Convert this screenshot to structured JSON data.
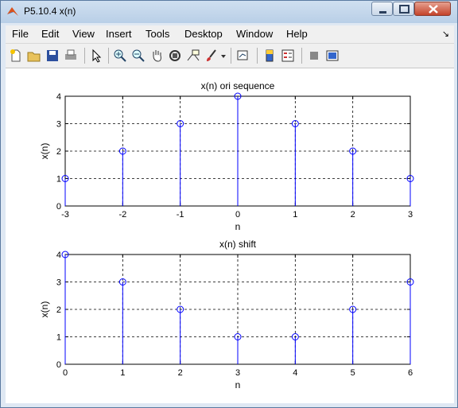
{
  "window": {
    "title": "P5.10.4 x(n)"
  },
  "menu": [
    "File",
    "Edit",
    "View",
    "Insert",
    "Tools",
    "Desktop",
    "Window",
    "Help"
  ],
  "toolbar": {
    "icons": [
      "new-figure-icon",
      "open-file-icon",
      "save-icon",
      "print-icon",
      "pointer-icon",
      "zoom-in-icon",
      "zoom-out-icon",
      "pan-hand-icon",
      "rotate-3d-icon",
      "data-cursor-icon",
      "brush-icon",
      "brush-dropdown-icon",
      "link-plot-icon",
      "insert-colorbar-icon",
      "insert-legend-icon",
      "hide-plot-tools-icon",
      "show-plot-tools-icon"
    ]
  },
  "colors": {
    "stem": "#0000ff",
    "axis": "#000000",
    "grid": "#000000"
  },
  "chart_data": [
    {
      "type": "stem",
      "title": "x(n) ori sequence",
      "xlabel": "n",
      "ylabel": "x(n)",
      "xlim": [
        -3,
        3
      ],
      "ylim": [
        0,
        4
      ],
      "xticks": [
        "-3",
        "-2",
        "-1",
        "0",
        "1",
        "2",
        "3"
      ],
      "yticks": [
        "0",
        "1",
        "2",
        "3",
        "4"
      ],
      "grid": true,
      "x": [
        -3,
        -2,
        -1,
        0,
        1,
        2,
        3
      ],
      "y": [
        1,
        2,
        3,
        4,
        3,
        2,
        1
      ]
    },
    {
      "type": "stem",
      "title": "x(n) shift",
      "xlabel": "n",
      "ylabel": "x(n)",
      "xlim": [
        0,
        6
      ],
      "ylim": [
        0,
        4
      ],
      "xticks": [
        "0",
        "1",
        "2",
        "3",
        "4",
        "5",
        "6"
      ],
      "yticks": [
        "0",
        "1",
        "2",
        "3",
        "4"
      ],
      "grid": true,
      "x": [
        0,
        1,
        2,
        3,
        4,
        5,
        6
      ],
      "y": [
        4,
        3,
        2,
        1,
        1,
        2,
        3
      ]
    }
  ]
}
